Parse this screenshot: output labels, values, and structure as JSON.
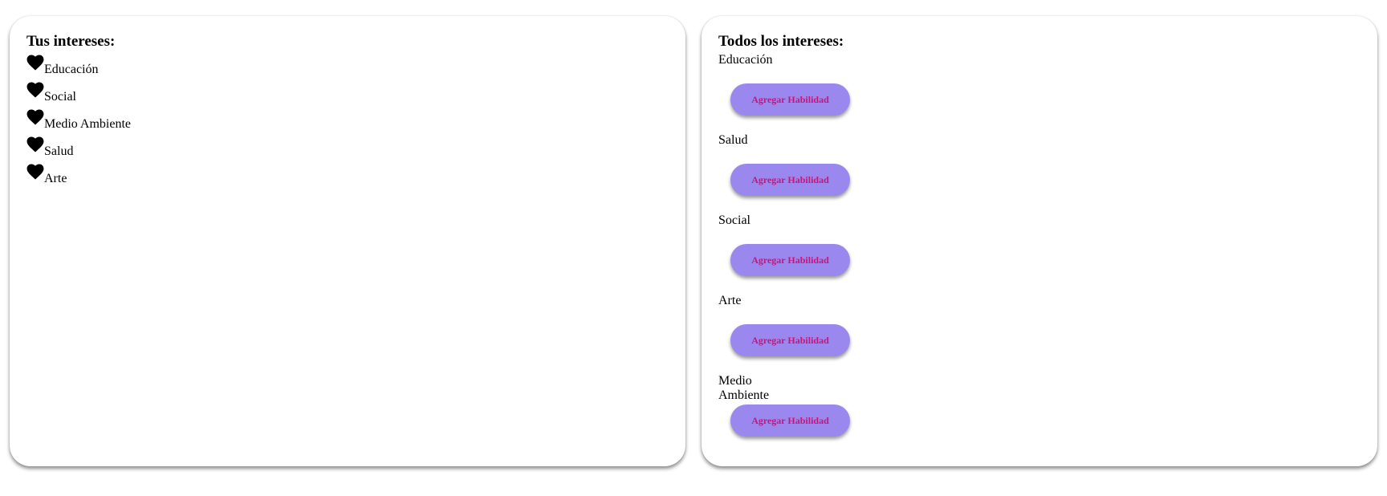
{
  "my_interests": {
    "title": "Tus intereses:",
    "icon": "heart-icon",
    "items": [
      {
        "label": "Educación"
      },
      {
        "label": "Social"
      },
      {
        "label": "Medio Ambiente"
      },
      {
        "label": "Salud"
      },
      {
        "label": "Arte"
      }
    ]
  },
  "all_interests": {
    "title": "Todos los intereses:",
    "button_color": "#9a88ee",
    "button_text_color": "#c8157a",
    "items": [
      {
        "label": "Educación",
        "button_label": "Agregar Habilidad"
      },
      {
        "label": "Salud",
        "button_label": "Agregar Habilidad"
      },
      {
        "label": "Social",
        "button_label": "Agregar Habilidad"
      },
      {
        "label": "Arte",
        "button_label": "Agregar Habilidad"
      },
      {
        "label": "Medio Ambiente",
        "button_label": "Agregar Habilidad"
      }
    ]
  }
}
